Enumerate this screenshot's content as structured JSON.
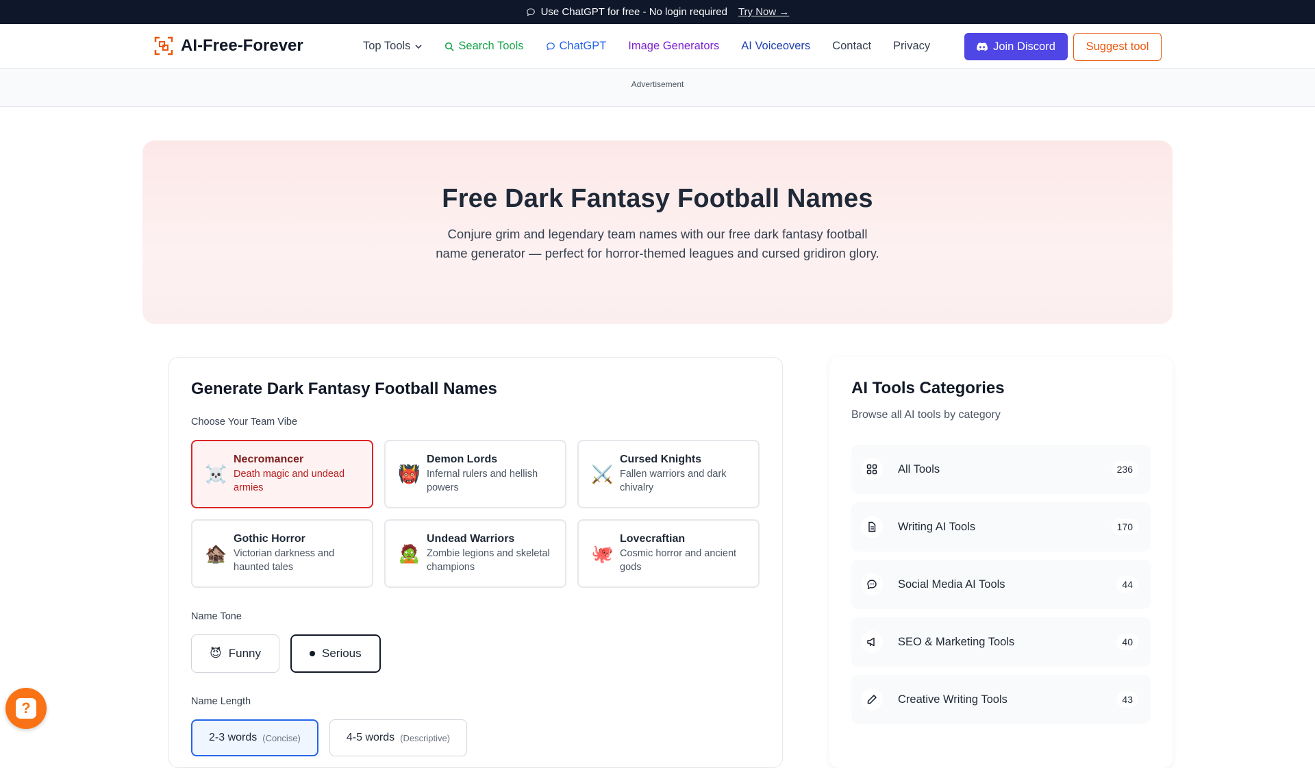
{
  "announcement": {
    "text": "Use ChatGPT for free - No login required",
    "link": "Try Now →"
  },
  "header": {
    "logo": "AI-Free-Forever",
    "nav": [
      {
        "label": "Top Tools",
        "icon": "chevron-down-icon"
      },
      {
        "label": "Search Tools",
        "icon": "search-icon"
      },
      {
        "label": "ChatGPT",
        "icon": "chat-bubble-icon"
      },
      {
        "label": "Image Generators"
      },
      {
        "label": "AI Voiceovers"
      },
      {
        "label": "Contact"
      },
      {
        "label": "Privacy"
      }
    ],
    "discord": "Join Discord",
    "suggest": "Suggest tool"
  },
  "ad": {
    "label": "Advertisement"
  },
  "hero": {
    "title": "Free Dark Fantasy Football Names",
    "subtitle": "Conjure grim and legendary team names with our free dark fantasy football name generator — perfect for horror-themed leagues and cursed gridiron glory."
  },
  "generator": {
    "title": "Generate Dark Fantasy Football Names",
    "vibe_label": "Choose Your Team Vibe",
    "vibes": [
      {
        "emoji": "☠️",
        "title": "Necromancer",
        "desc": "Death magic and undead armies"
      },
      {
        "emoji": "👹",
        "title": "Demon Lords",
        "desc": "Infernal rulers and hellish powers"
      },
      {
        "emoji": "⚔️",
        "title": "Cursed Knights",
        "desc": "Fallen warriors and dark chivalry"
      },
      {
        "emoji": "🏚️",
        "title": "Gothic Horror",
        "desc": "Victorian darkness and haunted tales"
      },
      {
        "emoji": "🧟",
        "title": "Undead Warriors",
        "desc": "Zombie legions and skeletal champions"
      },
      {
        "emoji": "🐙",
        "title": "Lovecraftian",
        "desc": "Cosmic horror and ancient gods"
      }
    ],
    "tone_label": "Name Tone",
    "tones": [
      {
        "emoji": "😈",
        "label": "Funny"
      },
      {
        "emoji": "●",
        "label": "Serious"
      }
    ],
    "length_label": "Name Length",
    "lengths": [
      {
        "label": "2-3 words",
        "sub": "(Concise)"
      },
      {
        "label": "4-5 words",
        "sub": "(Descriptive)"
      }
    ]
  },
  "categories": {
    "title": "AI Tools Categories",
    "subtitle": "Browse all AI tools by category",
    "items": [
      {
        "icon": "grid-icon",
        "name": "All Tools",
        "count": "236"
      },
      {
        "icon": "document-icon",
        "name": "Writing AI Tools",
        "count": "170"
      },
      {
        "icon": "chat-bubble-icon",
        "name": "Social Media AI Tools",
        "count": "44"
      },
      {
        "icon": "megaphone-icon",
        "name": "SEO & Marketing Tools",
        "count": "40"
      },
      {
        "icon": "pencil-icon",
        "name": "Creative Writing Tools",
        "count": "43"
      }
    ]
  },
  "colors": {
    "accent": "#4f46e5",
    "brand_orange": "#ea580c",
    "active_red": "#dc2626"
  }
}
